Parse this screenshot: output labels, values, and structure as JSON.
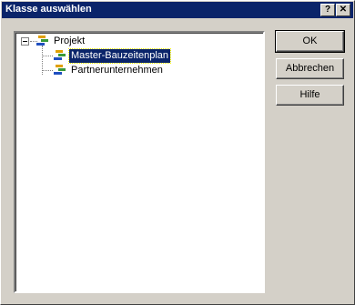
{
  "window": {
    "title": "Klasse auswählen",
    "help_glyph": "?",
    "close_glyph": "✕"
  },
  "tree": {
    "root": {
      "label": "Projekt",
      "icon": "class-icon",
      "expanded": true
    },
    "children": [
      {
        "label": "Master-Bauzeitenplan",
        "icon": "class-icon",
        "selected": true
      },
      {
        "label": "Partnerunternehmen",
        "icon": "class-icon",
        "selected": false
      }
    ]
  },
  "buttons": {
    "ok": "OK",
    "cancel": "Abbrechen",
    "help": "Hilfe"
  },
  "colors": {
    "titlebar": "#0a246a",
    "selection": "#0a246a",
    "face": "#d4d0c8"
  }
}
